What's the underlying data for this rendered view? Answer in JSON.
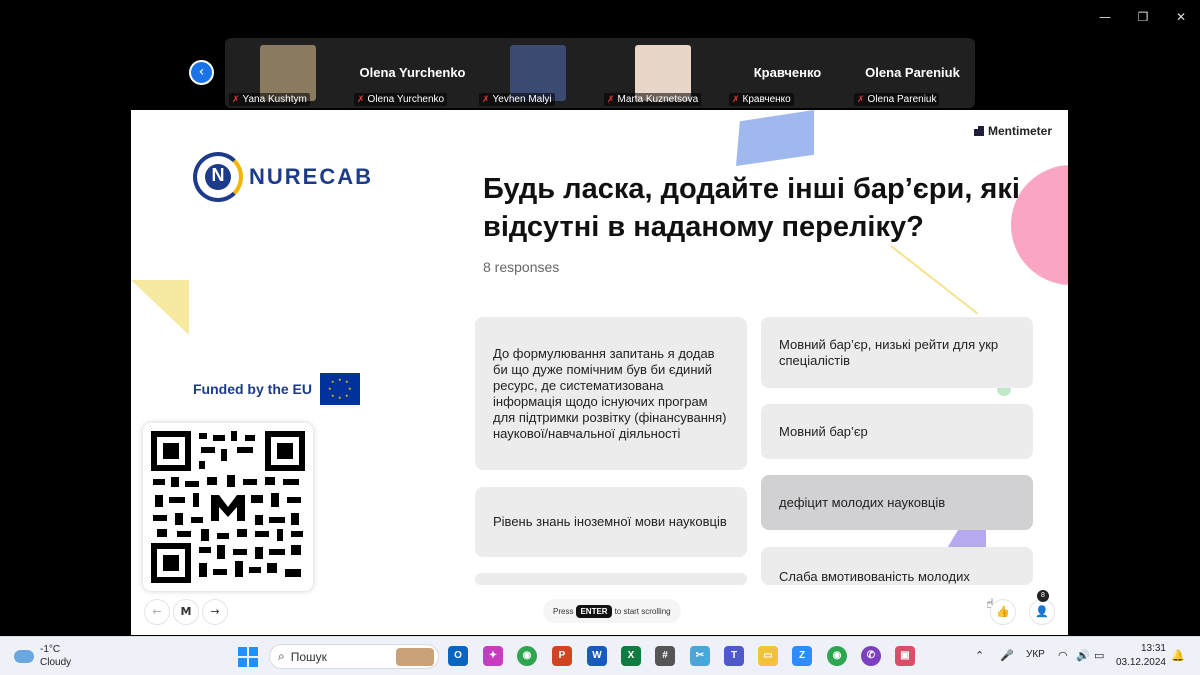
{
  "window": {
    "minimize": "—",
    "restore": "❐",
    "close": "✕"
  },
  "participants": [
    {
      "label": "Yana Kushtym",
      "big_name": "",
      "video": "#8a7a60"
    },
    {
      "label": "Olena Yurchenko",
      "big_name": "Olena Yurchenko",
      "video": ""
    },
    {
      "label": "Yevhen Malyi",
      "big_name": "",
      "video": "#3a4a70"
    },
    {
      "label": "Marta Kuznetsova",
      "big_name": "",
      "video": "#e8d6c8"
    },
    {
      "label": "Кравченко",
      "big_name": "Кравченко",
      "video": ""
    },
    {
      "label": "Olena Pareniuk",
      "big_name": "Olena Pareniuk",
      "video": ""
    }
  ],
  "slide": {
    "brand": "Mentimeter",
    "logo_text": "NURECAB",
    "logo_letter": "N",
    "title": "Будь ласка, додайте інші бар’єри, які відсутні в наданому переліку?",
    "responses": "8 responses",
    "funded": "Funded by the EU",
    "cards_left": [
      "До формулювання запитань я додав би що дуже помічним був би єдиний ресурс, де систематизована інформація щодо існуючих програм для підтримки розвітку (фінансування) наукової/навчальної діяльності",
      "Рівень знань іноземної мови науковців"
    ],
    "cards_right": [
      "Мовний бар’єр, низькі рейти для укр спеціалістів",
      "Мовний бар’єр",
      "дефіцит молодих науковців",
      "Слаба вмотивованість молодих"
    ],
    "hint_prefix": "Press",
    "hint_key": "ENTER",
    "hint_suffix": "to start scrolling",
    "participant_count": "8",
    "nav_prev": "←",
    "nav_next": "→",
    "menti_btn": "M",
    "like_icon": "👍",
    "user_icon": "👤"
  },
  "taskbar": {
    "temperature": "-1°C",
    "weather": "Cloudy",
    "search_placeholder": "Пошук",
    "language": "УКР",
    "time": "13:31",
    "date": "03.12.2024",
    "colors": {
      "accent": "#1e90ff"
    }
  }
}
